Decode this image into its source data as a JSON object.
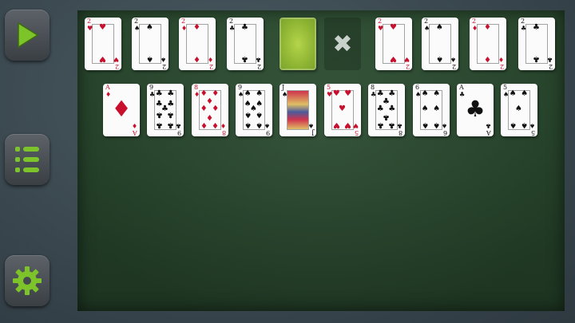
{
  "sidebar": {
    "play_icon": "play-icon",
    "menu_icon": "list-icon",
    "settings_icon": "gear-icon",
    "accent_color": "#7dc42b"
  },
  "stock": {
    "redeal_mark": "✖"
  },
  "row1": [
    {
      "rank": "2",
      "suit": "♥",
      "color": "red"
    },
    {
      "rank": "2",
      "suit": "♠",
      "color": "blk"
    },
    {
      "rank": "2",
      "suit": "♦",
      "color": "red"
    },
    {
      "rank": "2",
      "suit": "♣",
      "color": "blk"
    },
    {
      "rank": "2",
      "suit": "♥",
      "color": "red"
    },
    {
      "rank": "2",
      "suit": "♠",
      "color": "blk"
    },
    {
      "rank": "2",
      "suit": "♦",
      "color": "red"
    },
    {
      "rank": "2",
      "suit": "♣",
      "color": "blk"
    }
  ],
  "row2": [
    {
      "rank": "A",
      "suit": "♦",
      "color": "red"
    },
    {
      "rank": "9",
      "suit": "♣",
      "color": "blk"
    },
    {
      "rank": "8",
      "suit": "♦",
      "color": "red"
    },
    {
      "rank": "9",
      "suit": "♠",
      "color": "blk"
    },
    {
      "rank": "J",
      "suit": "♠",
      "color": "blk"
    },
    {
      "rank": "5",
      "suit": "♥",
      "color": "red"
    },
    {
      "rank": "8",
      "suit": "♣",
      "color": "blk"
    },
    {
      "rank": "6",
      "suit": "♠",
      "color": "blk"
    },
    {
      "rank": "A",
      "suit": "♣",
      "color": "blk"
    },
    {
      "rank": "5",
      "suit": "♠",
      "color": "blk"
    }
  ]
}
